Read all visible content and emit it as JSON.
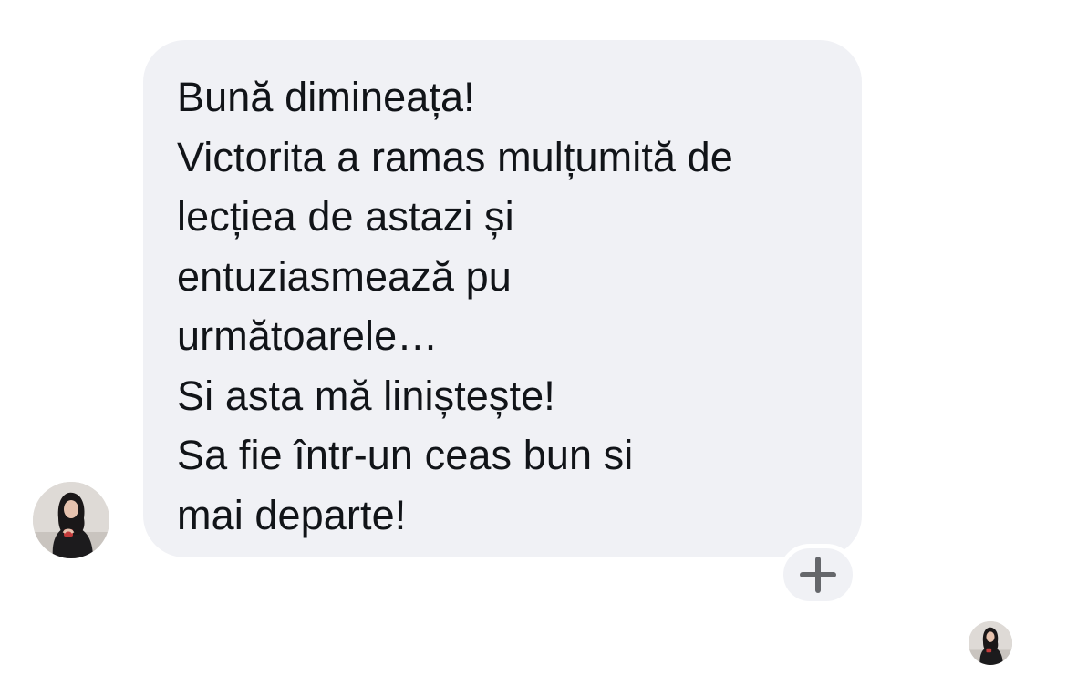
{
  "conversation": {
    "message": {
      "lines": [
        "Bună dimineața!",
        "Victorita a ramas mulțumită de",
        "lecțiea de astazi și",
        "entuziasmează pu",
        "următoarele…",
        "Si asta mă liniștește!",
        "Sa fie într-un ceas bun si",
        "mai departe!"
      ]
    },
    "reaction_button": {
      "icon": "plus-icon"
    },
    "sender_avatar": {
      "icon": "avatar"
    },
    "read_receipt": {
      "icon": "avatar"
    }
  },
  "colors": {
    "bubble_background": "#f0f1f5",
    "text": "#111418",
    "plus_icon": "#65676b",
    "page_background": "#ffffff"
  }
}
